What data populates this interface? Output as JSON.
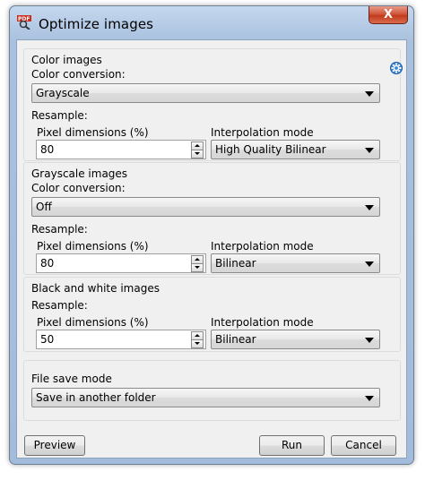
{
  "window": {
    "title": "Optimize images",
    "close_label": "X"
  },
  "color_images": {
    "heading": "Color images",
    "color_conversion_label": "Color conversion:",
    "color_conversion_value": "Grayscale",
    "resample_label": "Resample:",
    "pixel_label": "Pixel dimensions (%)",
    "pixel_value": "80",
    "interp_label": "Interpolation mode",
    "interp_value": "High Quality Bilinear"
  },
  "grayscale_images": {
    "heading": "Grayscale images",
    "color_conversion_label": "Color conversion:",
    "color_conversion_value": "Off",
    "resample_label": "Resample:",
    "pixel_label": "Pixel dimensions (%)",
    "pixel_value": "80",
    "interp_label": "Interpolation mode",
    "interp_value": "Bilinear"
  },
  "bw_images": {
    "heading": "Black and white images",
    "resample_label": "Resample:",
    "pixel_label": "Pixel dimensions (%)",
    "pixel_value": "50",
    "interp_label": "Interpolation mode",
    "interp_value": "Bilinear"
  },
  "file_save": {
    "label": "File save mode",
    "value": "Save in another folder"
  },
  "buttons": {
    "preview": "Preview",
    "run": "Run",
    "cancel": "Cancel"
  },
  "icons": {
    "app": "pdf-app-icon",
    "settings": "gear-icon"
  }
}
